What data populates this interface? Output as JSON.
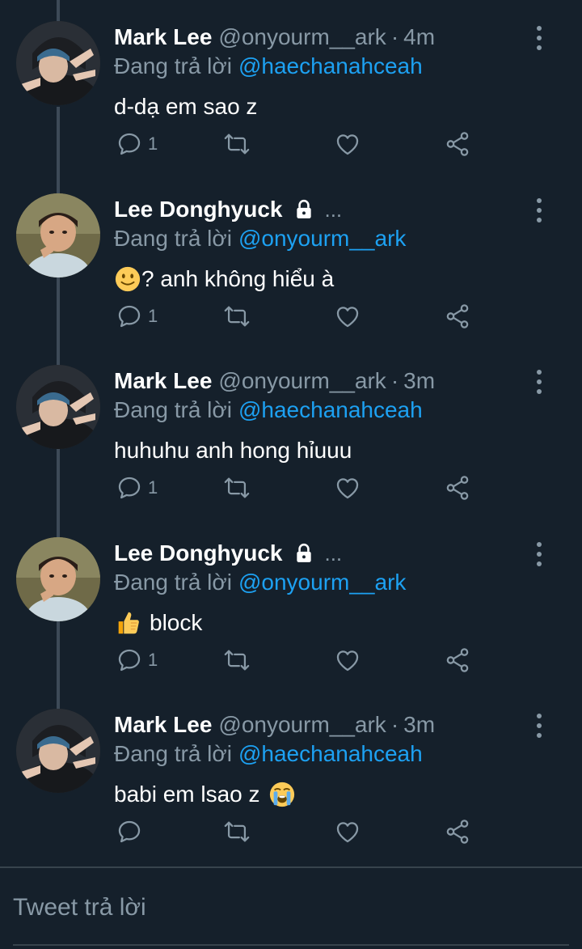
{
  "thread": {
    "tweets": [
      {
        "name": "Mark Lee",
        "handle": "@onyourm__ark",
        "separator": "·",
        "time": "4m",
        "locked": false,
        "reply_prefix": "Đang trả lời",
        "reply_to": "@haechanahceah",
        "text": "d-dạ em sao z",
        "emoji_before": "",
        "emoji_after": "",
        "reply_count": "1",
        "avatar": "mark-lee-avatar"
      },
      {
        "name": "Lee Donghyuck",
        "handle": "",
        "separator": "",
        "time": "",
        "locked": true,
        "ellipsis": "...",
        "reply_prefix": "Đang trả lời",
        "reply_to": "@onyourm__ark",
        "text": "? anh không hiểu à",
        "emoji_before": "slightly-smiling-face-emoji",
        "emoji_after": "",
        "reply_count": "1",
        "avatar": "lee-donghyuck-avatar"
      },
      {
        "name": "Mark Lee",
        "handle": "@onyourm__ark",
        "separator": "·",
        "time": "3m",
        "locked": false,
        "reply_prefix": "Đang trả lời",
        "reply_to": "@haechanahceah",
        "text": "huhuhu anh hong hỉuuu",
        "emoji_before": "",
        "emoji_after": "",
        "reply_count": "1",
        "avatar": "mark-lee-avatar"
      },
      {
        "name": "Lee Donghyuck",
        "handle": "",
        "separator": "",
        "time": "",
        "locked": true,
        "ellipsis": "...",
        "reply_prefix": "Đang trả lời",
        "reply_to": "@onyourm__ark",
        "text": "block",
        "emoji_before": "thumbs-up-emoji",
        "emoji_after": "",
        "reply_count": "1",
        "avatar": "lee-donghyuck-avatar"
      },
      {
        "name": "Mark Lee",
        "handle": "@onyourm__ark",
        "separator": "·",
        "time": "3m",
        "locked": false,
        "reply_prefix": "Đang trả lời",
        "reply_to": "@haechanahceah",
        "text": "babi em lsao z",
        "emoji_before": "",
        "emoji_after": "loudly-crying-face-emoji",
        "reply_count": "",
        "avatar": "mark-lee-avatar"
      }
    ]
  },
  "compose": {
    "placeholder": "Tweet trả lời"
  },
  "icons": {
    "reply": "reply-icon",
    "retweet": "retweet-icon",
    "like": "heart-icon",
    "share": "share-icon",
    "more": "more-vertical-icon",
    "lock": "lock-icon"
  },
  "colors": {
    "background": "#15202b",
    "link": "#1da1f2",
    "secondary_text": "#8899a6",
    "divider": "#38444d"
  }
}
